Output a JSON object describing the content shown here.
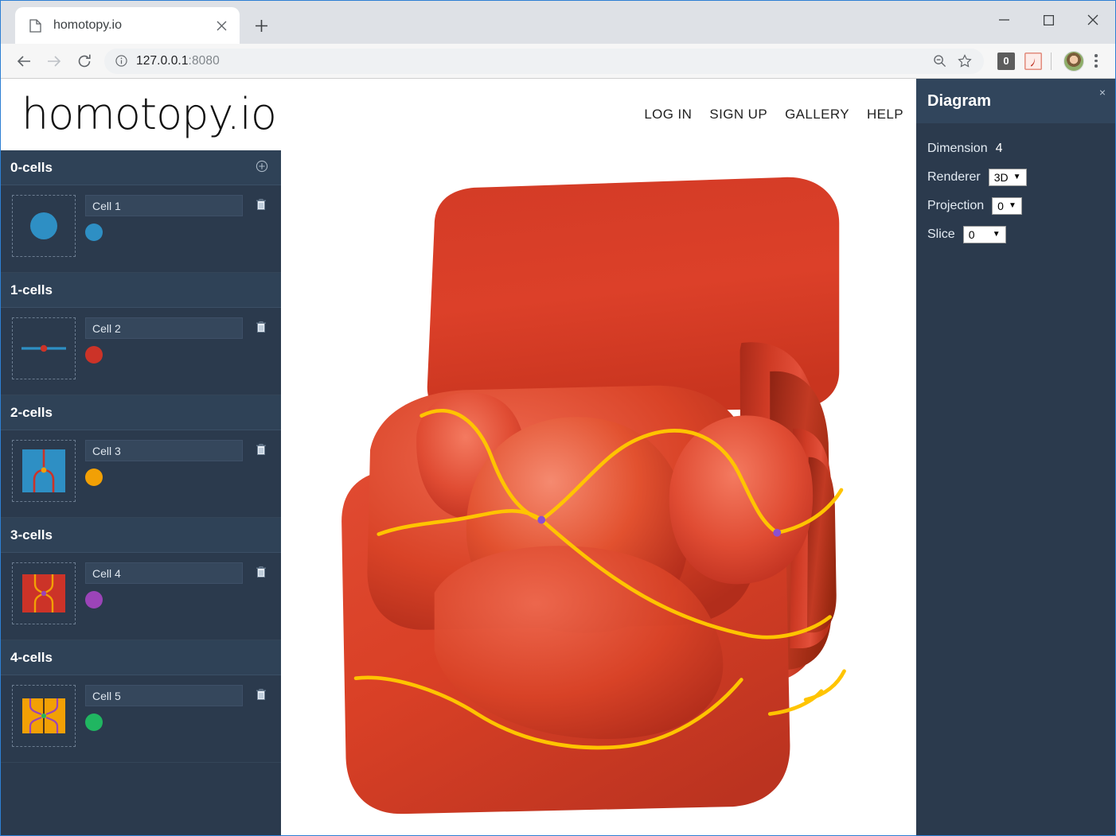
{
  "browser": {
    "tab": {
      "title": "homotopy.io",
      "favicon_icon": "page-icon",
      "close_icon": "close-icon"
    },
    "new_tab_icon": "plus-icon",
    "window_controls": {
      "minimize": "minimize-icon",
      "maximize": "maximize-icon",
      "close": "close-icon"
    },
    "back_icon": "arrow-left-icon",
    "forward_icon": "arrow-right-icon",
    "reload_icon": "reload-icon",
    "url": {
      "host": "127.0.0.1",
      "port": ":8080",
      "full": "127.0.0.1:8080",
      "info_icon": "info-circle-icon"
    },
    "omnibox_icons": [
      "zoom-out-icon",
      "star-icon"
    ],
    "extensions": [
      {
        "name": "counter-extension-icon",
        "badge": "0"
      },
      {
        "name": "pdf-extension-icon",
        "badge": ""
      }
    ],
    "profile_icon": "avatar",
    "menu_icon": "three-dots-icon"
  },
  "site": {
    "logo": "homotopy.io",
    "nav": [
      {
        "label": "LOG IN",
        "name": "nav-log-in"
      },
      {
        "label": "SIGN UP",
        "name": "nav-sign-up"
      },
      {
        "label": "GALLERY",
        "name": "nav-gallery"
      },
      {
        "label": "HELP",
        "name": "nav-help"
      }
    ]
  },
  "signature": {
    "groups": [
      {
        "title": "0-cells",
        "add_icon": "plus-circle-icon",
        "cells": [
          {
            "name": "Cell 1",
            "color": "#2e8fc4",
            "thumb": "point",
            "delete_icon": "trash-icon"
          }
        ]
      },
      {
        "title": "1-cells",
        "add_icon": "plus-circle-icon",
        "cells": [
          {
            "name": "Cell 2",
            "color": "#cc3328",
            "thumb": "wire",
            "delete_icon": "trash-icon"
          }
        ]
      },
      {
        "title": "2-cells",
        "add_icon": "plus-circle-icon",
        "cells": [
          {
            "name": "Cell 3",
            "color": "#f2a005",
            "thumb": "merge",
            "delete_icon": "trash-icon"
          }
        ]
      },
      {
        "title": "3-cells",
        "add_icon": "plus-circle-icon",
        "cells": [
          {
            "name": "Cell 4",
            "color": "#9b44b8",
            "thumb": "braid",
            "delete_icon": "trash-icon"
          }
        ]
      },
      {
        "title": "4-cells",
        "add_icon": "plus-circle-icon",
        "cells": [
          {
            "name": "Cell 5",
            "color": "#20b661",
            "thumb": "cross",
            "delete_icon": "trash-icon"
          }
        ]
      }
    ]
  },
  "diagram_panel": {
    "title": "Diagram",
    "close_label": "×",
    "dimension_label": "Dimension",
    "dimension_value": "4",
    "renderer_label": "Renderer",
    "renderer_value": "3D",
    "projection_label": "Projection",
    "projection_value": "0",
    "slice_label": "Slice",
    "slice_value": "0",
    "caret": "▼"
  },
  "viewport": {
    "surface_color": "#dd3b26",
    "surface_highlight": "#f0604a",
    "surface_shadow": "#b8301d",
    "wire_color": "#ffc400",
    "point_color": "#8b50d0",
    "background": "#ffffff"
  }
}
